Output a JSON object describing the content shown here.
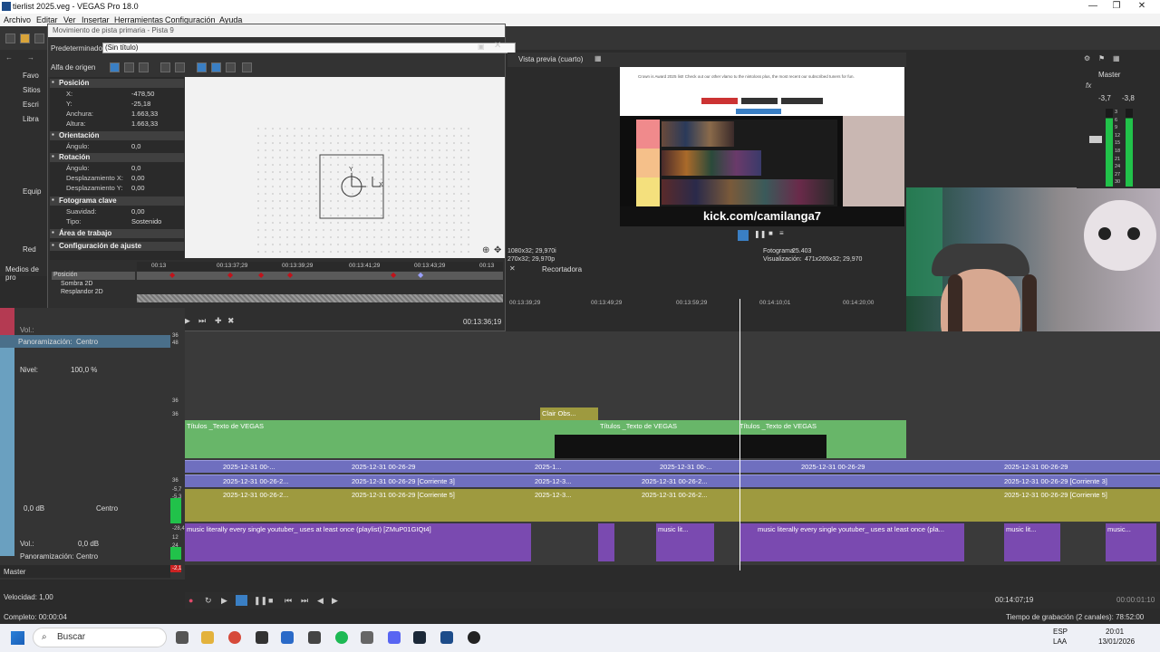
{
  "window": {
    "title": "tierlist 2025.veg - VEGAS Pro 18.0",
    "minimize": "—",
    "maximize": "❐",
    "close": "✕"
  },
  "menu": [
    "Archivo",
    "Editar",
    "Ver",
    "Insertar",
    "Herramientas",
    "Configuración",
    "Ayuda"
  ],
  "explorer": {
    "items": [
      "Favo",
      "Sitios",
      "Escri",
      "Libra",
      "Equip",
      "Red"
    ],
    "footer": "Medios de pro"
  },
  "dialog": {
    "title": "Movimiento de pista primaria - Pista 9",
    "preset_label": "Predeterminado:",
    "preset_value": "(Sin título)",
    "origin_label": "Alfa de origen",
    "sections": {
      "position": "Posición",
      "orientation": "Orientación",
      "rotation": "Rotación",
      "keyframe": "Fotograma clave",
      "workarea": "Área de trabajo",
      "settings": "Configuración de ajuste"
    },
    "props": {
      "x_label": "X:",
      "x": "-478,50",
      "y_label": "Y:",
      "y": "-25,18",
      "w_label": "Anchura:",
      "w": "1.663,33",
      "h_label": "Altura:",
      "h": "1.663,33",
      "angle_label": "Ángulo:",
      "angle": "0,0",
      "rangle_label": "Ángulo:",
      "rangle": "0,0",
      "dx_label": "Desplazamiento X:",
      "dx": "0,00",
      "dy_label": "Desplazamiento Y:",
      "dy": "0,00",
      "smooth_label": "Suavidad:",
      "smooth": "0,00",
      "type_label": "Tipo:",
      "type": "Sostenido"
    },
    "canvas_labels": {
      "y": "Y",
      "x": "X"
    },
    "kf_ruler": [
      "00:13",
      "00:13:37;29",
      "00:13:39;29",
      "00:13:41;29",
      "00:13:43;29",
      "00:13"
    ],
    "kf_tracks": [
      "Posición",
      "Sombra 2D",
      "Resplandor 2D"
    ],
    "time": "00:13:36;19"
  },
  "preview": {
    "label": "Vista previa (cuarto)",
    "kick": "kick.com/camilanga7",
    "banner_text": "Crown is Award 2025 list! Check out our other vlamo tu the nintoloss plus, the most recent our subscribed tuners for fun.",
    "left_info1": "1080x32; 29,970i",
    "left_info2": "270x32; 29,970p",
    "frame_label": "Fotograma:",
    "frame": "25.403",
    "display_label": "Visualización:",
    "display": "471x265x32; 29,970",
    "tier_colors": [
      "#f08a8c",
      "#f5c08a",
      "#f4e07d"
    ]
  },
  "master": {
    "label": "Master",
    "db_left": "-3,7",
    "db_right": "-3,8",
    "scale": [
      "3",
      "6",
      "9",
      "12",
      "15",
      "18",
      "21",
      "24",
      "27",
      "30"
    ]
  },
  "timeline": {
    "tab": "Recortadora",
    "ruler": [
      "00:13:39;29",
      "00:13:49;29",
      "00:13:59;29",
      "00:14:10;01",
      "00:14:20;00"
    ],
    "headers": {
      "vol": "Vol.:",
      "pan": "Panoramización:",
      "pan_val": "Centro",
      "nivel": "Nivel:",
      "nivel_val": "100,0 %",
      "db1": "0,0 dB",
      "centro1": "Centro",
      "vol2": "Vol.:",
      "db2": "0,0 dB",
      "pan2": "Panoramización:",
      "centro2": "Centro",
      "master": "Master",
      "meter_top": [
        "36",
        "48"
      ],
      "meter_nums": [
        "36",
        "36",
        "36",
        "-5,7",
        "-5,3"
      ],
      "meter_nums2": [
        "-28,4",
        "12",
        "24",
        "-2,1"
      ]
    },
    "clips": {
      "titles": "Títulos _Texto de VEGAS",
      "clair": "Clair Obs...",
      "dt1": "2025-12-31 00-...",
      "dt2": "2025-12-31 00-26-29",
      "dt3": "2025-12-31 00-26-2...",
      "dt4": "2025-12-31 00-26-29 [Corriente 3]",
      "dt5": "2025-12-31 00-26-29 [Corriente 5]",
      "dt6": "2025-12-3...",
      "dt7": "2025-1...",
      "music": "music literally every single youtuber_ uses at least once (playlist) [ZMuP01GIQt4]",
      "music_short": "music lit...",
      "music2": "music literally every single youtuber_ uses at least once (pla...",
      "music3": "music..."
    }
  },
  "transport": {
    "speed": "Velocidad: 1,00",
    "time": "00:14:07;19",
    "timer": "00:00:01:10"
  },
  "status": {
    "left": "Completo: 00:00:04",
    "right": "Tiempo de grabación (2 canales): 78:52:00"
  },
  "taskbar": {
    "search": "Buscar",
    "lang": "ESP",
    "lang2": "LAA",
    "time": "20:01",
    "date": "13/01/2026"
  }
}
